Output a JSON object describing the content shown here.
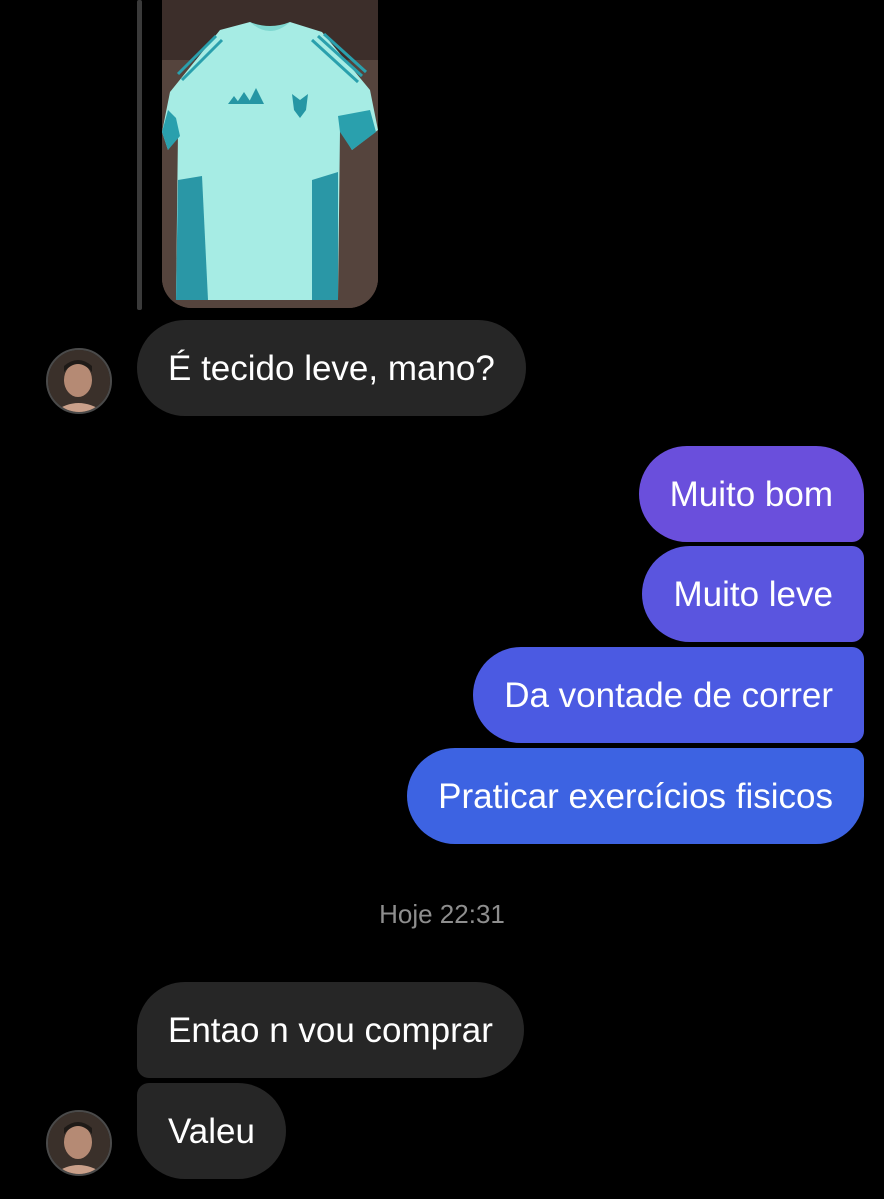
{
  "shared_photo": {
    "description_icon": "photo-icon"
  },
  "messages": [
    {
      "id": "in-1",
      "direction": "incoming",
      "text": "É tecido leve, mano?"
    },
    {
      "id": "out-1",
      "direction": "outgoing",
      "text": "Muito bom"
    },
    {
      "id": "out-2",
      "direction": "outgoing",
      "text": "Muito leve"
    },
    {
      "id": "out-3",
      "direction": "outgoing",
      "text": "Da vontade de correr"
    },
    {
      "id": "out-4",
      "direction": "outgoing",
      "text": "Praticar exercícios fisicos"
    },
    {
      "id": "in-2",
      "direction": "incoming",
      "text": "Entao n vou comprar"
    },
    {
      "id": "in-3",
      "direction": "incoming",
      "text": "Valeu"
    }
  ],
  "timestamp": "Hoje 22:31",
  "colors": {
    "incoming_bubble": "#262626",
    "outgoing_top": "#6a4fdc",
    "outgoing_bottom": "#3d63e2",
    "background": "#000000",
    "timestamp": "#8e8e8e"
  }
}
